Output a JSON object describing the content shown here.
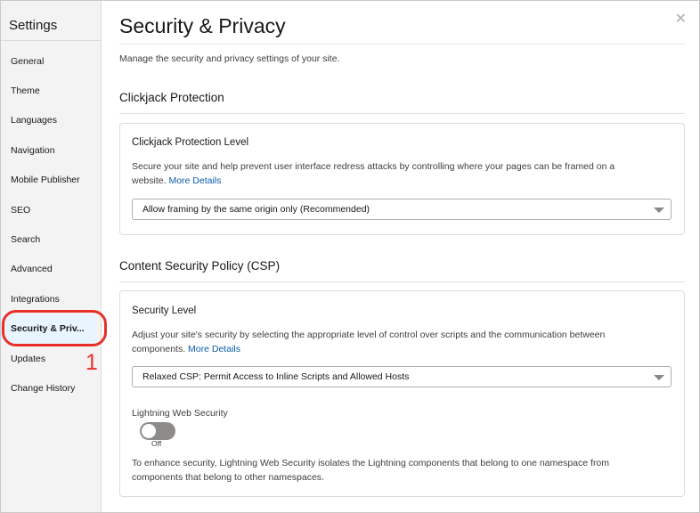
{
  "sidebar": {
    "title": "Settings",
    "items": [
      {
        "label": "General"
      },
      {
        "label": "Theme"
      },
      {
        "label": "Languages"
      },
      {
        "label": "Navigation"
      },
      {
        "label": "Mobile Publisher"
      },
      {
        "label": "SEO"
      },
      {
        "label": "Search"
      },
      {
        "label": "Advanced"
      },
      {
        "label": "Integrations"
      },
      {
        "label": "Security & Priv..."
      },
      {
        "label": "Updates"
      },
      {
        "label": "Change History"
      }
    ],
    "active_index": 9
  },
  "annotation": {
    "number": "1",
    "color": "#e8302b"
  },
  "header": {
    "close_glyph": "✕",
    "title": "Security & Privacy",
    "description": "Manage the security and privacy settings of your site."
  },
  "clickjack": {
    "section_title": "Clickjack Protection",
    "card_title": "Clickjack Protection Level",
    "text_line1": "Secure your site and help prevent user interface redress attacks by controlling where your pages can be framed on a",
    "text_line2": "website.",
    "link": "More Details",
    "select_value": "Allow framing by the same origin only (Recommended)"
  },
  "csp": {
    "section_title": "Content Security Policy (CSP)",
    "card_title": "Security Level",
    "text_line1": "Adjust your site's security by selecting the appropriate level of control over scripts and the communication between",
    "text_line2": "components.",
    "link": "More Details",
    "select_value": "Relaxed CSP: Permit Access to Inline Scripts and Allowed Hosts",
    "lws_label": "Lightning Web Security",
    "lws_state": "Off",
    "lws_text_line1": "To enhance security, Lightning Web Security isolates the Lightning components that belong to one namespace from",
    "lws_text_line2": "components that belong to other namespaces."
  },
  "colors": {
    "link": "#0b5cab",
    "active_bg": "#e8f4ff",
    "toggle_off": "#8e8c8a"
  }
}
